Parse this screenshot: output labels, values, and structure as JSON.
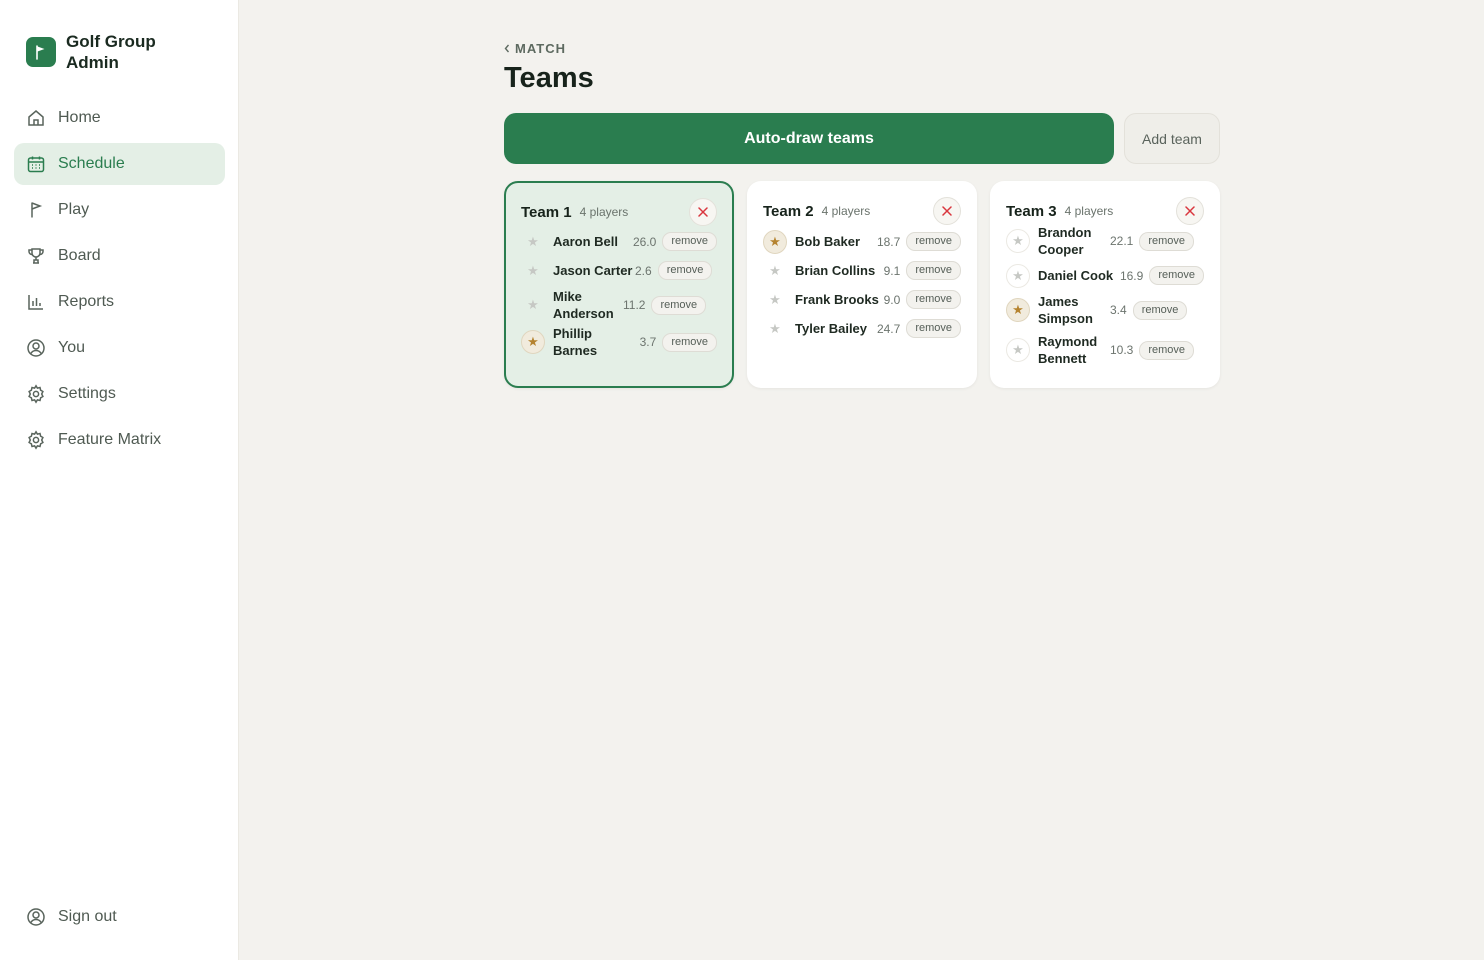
{
  "brand": {
    "title": "Golf Group Admin"
  },
  "nav": {
    "items": [
      {
        "label": "Home",
        "icon": "home-icon"
      },
      {
        "label": "Schedule",
        "icon": "calendar-icon",
        "active": true
      },
      {
        "label": "Play",
        "icon": "flag-icon"
      },
      {
        "label": "Board",
        "icon": "trophy-icon"
      },
      {
        "label": "Reports",
        "icon": "bar-chart-icon"
      },
      {
        "label": "You",
        "icon": "user-circle-icon"
      },
      {
        "label": "Settings",
        "icon": "gear-icon"
      },
      {
        "label": "Feature Matrix",
        "icon": "gear-icon"
      }
    ],
    "signout": "Sign out"
  },
  "header": {
    "back_label": "MATCH",
    "title": "Teams"
  },
  "actions": {
    "autodraw": "Auto-draw teams",
    "add_team": "Add team"
  },
  "teams": [
    {
      "name": "Team 1",
      "count": "4 players",
      "selected": true,
      "players": [
        {
          "name": "Aaron Bell",
          "hcp": "26.0",
          "captain": false
        },
        {
          "name": "Jason Carter",
          "hcp": "2.6",
          "captain": false
        },
        {
          "name": "Mike Anderson",
          "hcp": "11.2",
          "captain": false
        },
        {
          "name": "Phillip Barnes",
          "hcp": "3.7",
          "captain": true
        }
      ]
    },
    {
      "name": "Team 2",
      "count": "4 players",
      "selected": false,
      "players": [
        {
          "name": "Bob Baker",
          "hcp": "18.7",
          "captain": true
        },
        {
          "name": "Brian Collins",
          "hcp": "9.1",
          "captain": false
        },
        {
          "name": "Frank Brooks",
          "hcp": "9.0",
          "captain": false
        },
        {
          "name": "Tyler Bailey",
          "hcp": "24.7",
          "captain": false
        }
      ]
    },
    {
      "name": "Team 3",
      "count": "4 players",
      "selected": false,
      "players": [
        {
          "name": "Brandon Cooper",
          "hcp": "22.1",
          "captain": false
        },
        {
          "name": "Daniel Cook",
          "hcp": "16.9",
          "captain": false
        },
        {
          "name": "James Simpson",
          "hcp": "3.4",
          "captain": true
        },
        {
          "name": "Raymond Bennett",
          "hcp": "10.3",
          "captain": false
        }
      ]
    }
  ],
  "remove_label": "remove",
  "colors": {
    "accent": "#2a7d4f",
    "accent_soft": "#e4efe6",
    "danger": "#d9363e",
    "captain": "#b5832f"
  }
}
